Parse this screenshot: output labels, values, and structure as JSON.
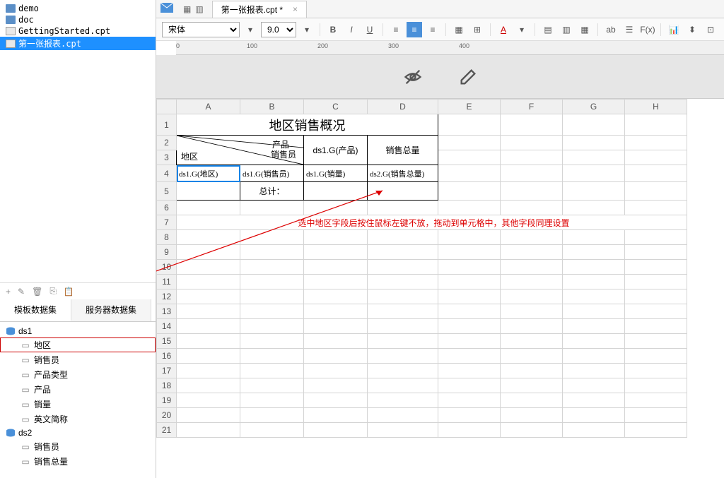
{
  "fileTree": [
    {
      "type": "folder",
      "name": "demo"
    },
    {
      "type": "folder",
      "name": "doc"
    },
    {
      "type": "file",
      "name": "GettingStarted.cpt"
    },
    {
      "type": "file",
      "name": "第一张报表.cpt",
      "selected": true
    }
  ],
  "datasetTabs": {
    "template": "模板数据集",
    "server": "服务器数据集"
  },
  "datasets": [
    {
      "name": "ds1",
      "fields": [
        "地区",
        "销售员",
        "产品类型",
        "产品",
        "销量",
        "英文简称"
      ],
      "highlightField": "地区"
    },
    {
      "name": "ds2",
      "fields": [
        "销售员",
        "销售总量"
      ]
    }
  ],
  "docTab": "第一张报表.cpt *",
  "toolbar": {
    "font": "宋体",
    "fontSize": "9.0"
  },
  "ruler": {
    "marks": [
      "0",
      "100",
      "200",
      "300",
      "400"
    ]
  },
  "columns": [
    "A",
    "B",
    "C",
    "D",
    "E",
    "F",
    "G",
    "H"
  ],
  "report": {
    "title": "地区销售概况",
    "diagLabels": {
      "top": "产品",
      "mid": "销售员",
      "bot": "地区"
    },
    "headerC": "ds1.G(产品)",
    "headerD": "销售总量",
    "row4": {
      "A": "ds1.G(地区)",
      "B": "ds1.G(销售员)",
      "C": "ds1.G(销量)",
      "D": "ds2.G(销售总量)"
    },
    "row5B": "总计："
  },
  "annotation": "选中地区字段后按住鼠标左键不放，拖动到单元格中，其他字段同理设置",
  "rowCount": 21
}
